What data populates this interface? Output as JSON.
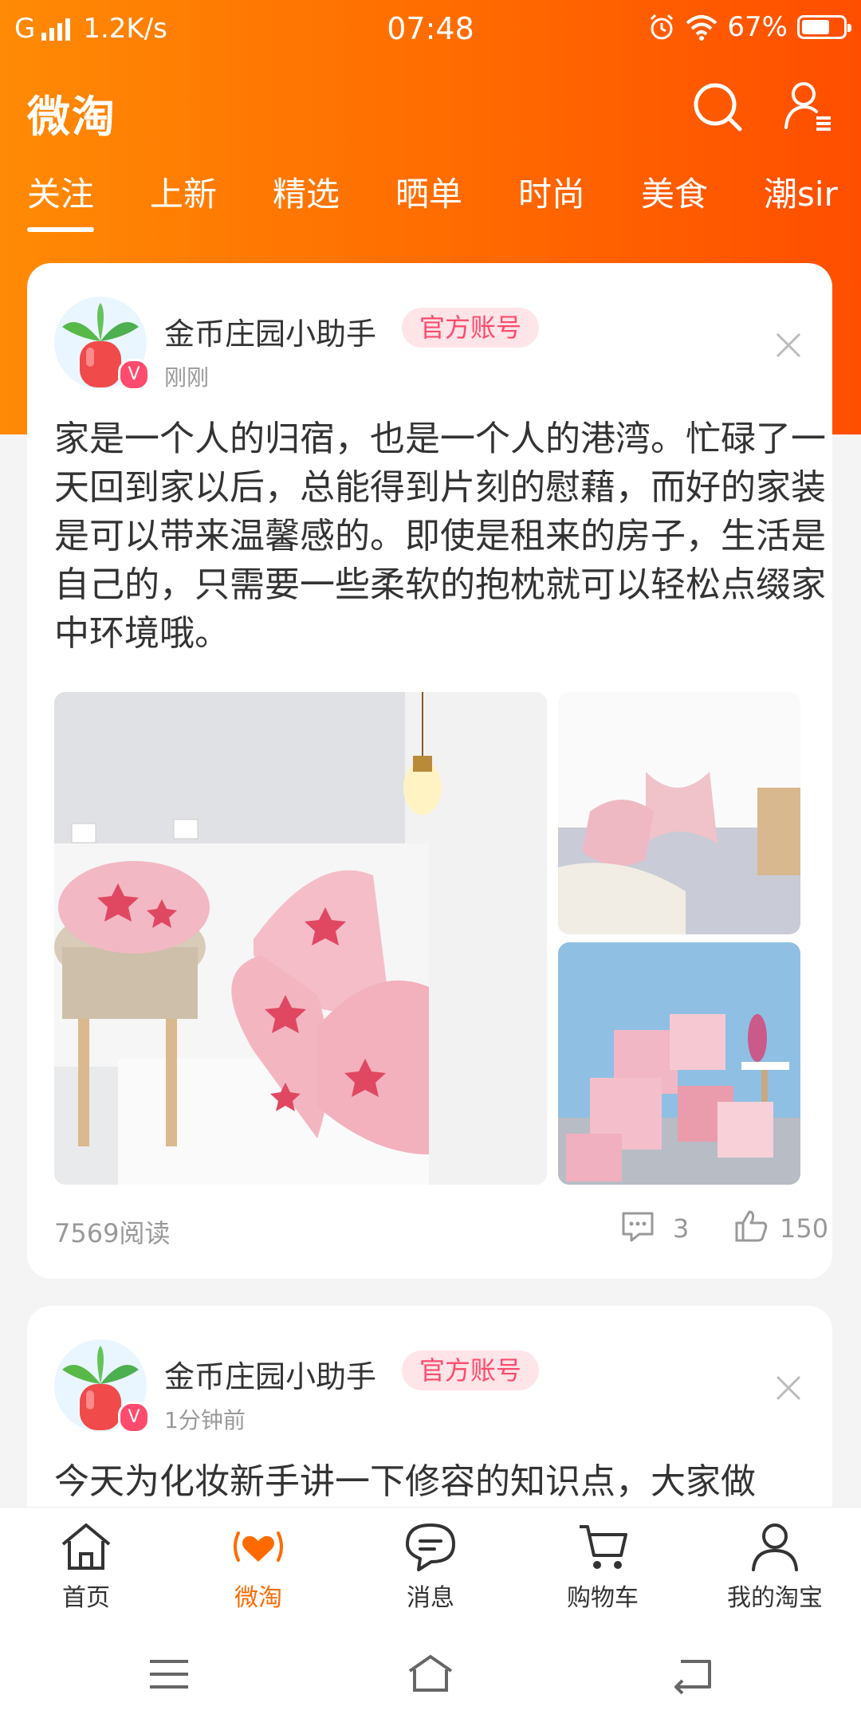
{
  "status_bar": {
    "network": "G",
    "speed": "1.2K/s",
    "time": "07:48",
    "battery": "67%",
    "battery_level": 0.67
  },
  "header": {
    "title": "微淘",
    "icons": [
      "search-icon",
      "user-icon"
    ]
  },
  "tabs": [
    {
      "label": "关注",
      "active": true
    },
    {
      "label": "上新"
    },
    {
      "label": "精选"
    },
    {
      "label": "晒单"
    },
    {
      "label": "时尚"
    },
    {
      "label": "美食"
    },
    {
      "label": "潮sir"
    }
  ],
  "posts": [
    {
      "author": "金币庄园小助手",
      "tag": "官方账号",
      "time": "刚刚",
      "text": "家是一个人的归宿，也是一个人的港湾。忙碌了一天回到家以后，总能得到片刻的慰藉，而好的家装是可以带来温馨感的。即使是租来的房子，生活是自己的，只需要一些柔软的抱枕就可以轻松点缀家中环境哦。",
      "reads": "7569阅读",
      "comments": "3",
      "likes": "150"
    },
    {
      "author": "金币庄园小助手",
      "tag": "官方账号",
      "time": "1分钟前",
      "text": "今天为化妆新手讲一下修容的知识点，大家做"
    }
  ],
  "bottom_nav": [
    {
      "label": "首页",
      "icon": "home-icon"
    },
    {
      "label": "微淘",
      "icon": "weitao-heart-icon",
      "active": true
    },
    {
      "label": "消息",
      "icon": "message-icon"
    },
    {
      "label": "购物车",
      "icon": "cart-icon"
    },
    {
      "label": "我的淘宝",
      "icon": "profile-icon"
    }
  ],
  "system_nav": [
    "menu-icon",
    "home-icon",
    "back-icon"
  ],
  "colors": {
    "brand_orange": "#ff6a00",
    "tag_pink": "#ff4b6e",
    "tag_bg": "#ffe4e8"
  }
}
